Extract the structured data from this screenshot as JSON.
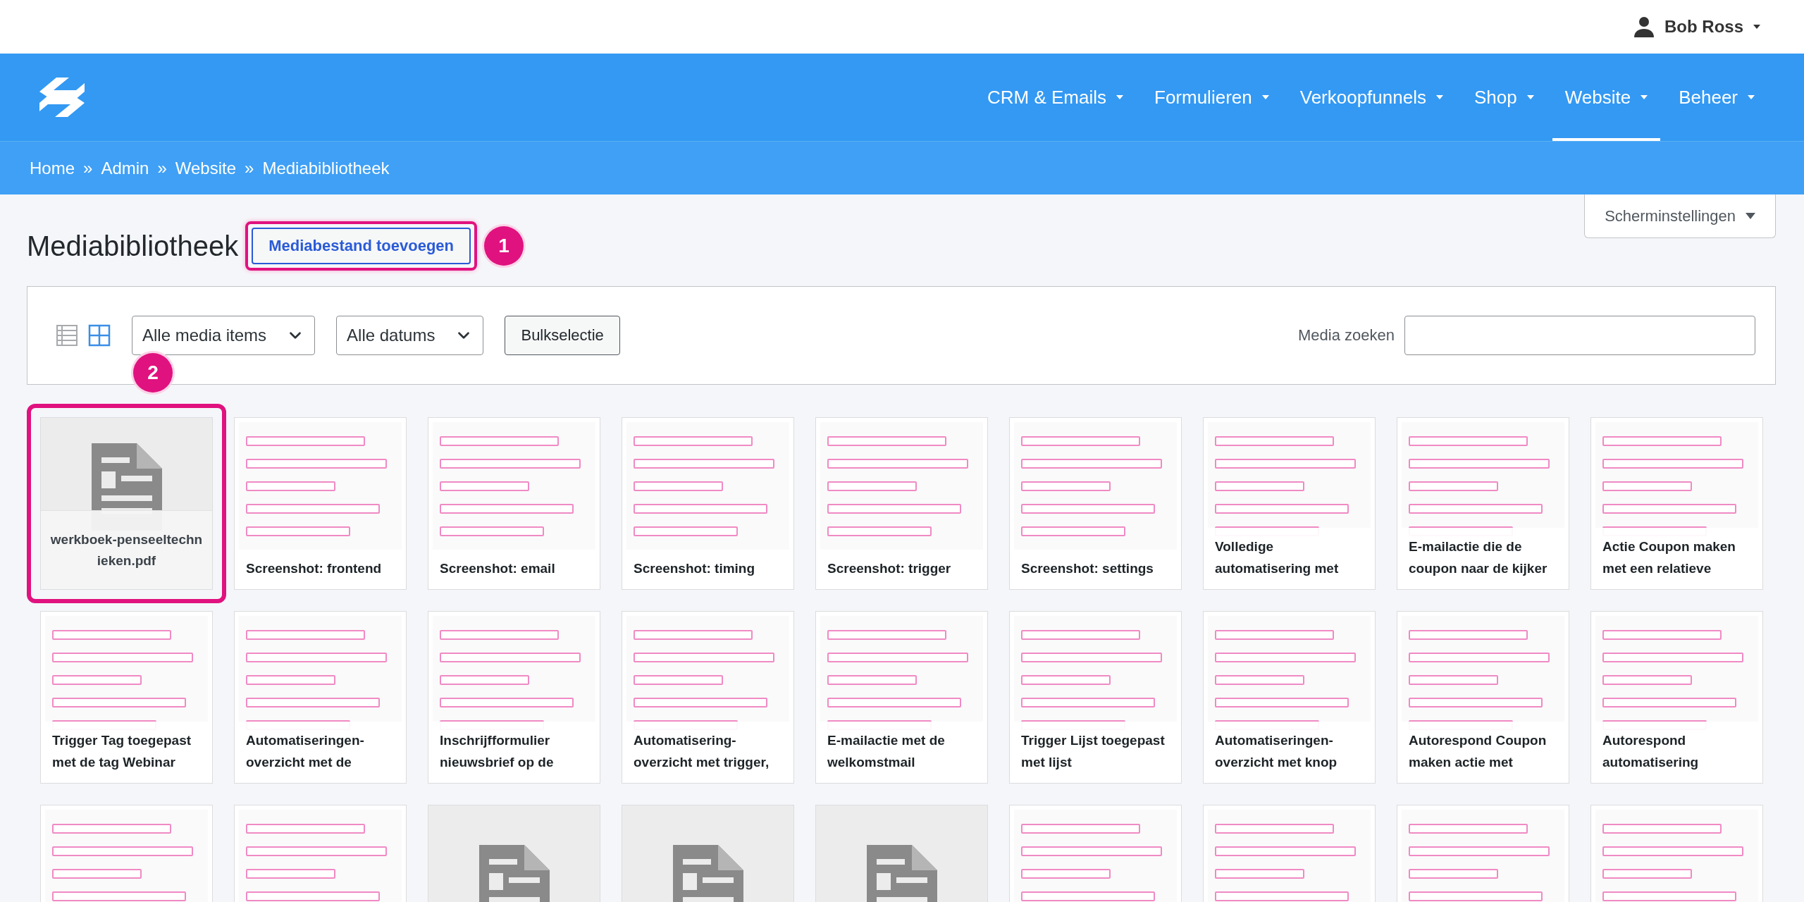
{
  "header": {
    "user": "Bob Ross"
  },
  "nav": {
    "items": [
      {
        "label": "CRM & Emails",
        "selected": false
      },
      {
        "label": "Formulieren",
        "selected": false
      },
      {
        "label": "Verkoopfunnels",
        "selected": false
      },
      {
        "label": "Shop",
        "selected": false
      },
      {
        "label": "Website",
        "selected": true
      },
      {
        "label": "Beheer",
        "selected": false
      }
    ]
  },
  "breadcrumb": [
    "Home",
    "»",
    "Admin",
    "»",
    "Website",
    "»",
    "Mediabibliotheek"
  ],
  "page": {
    "title": "Mediabibliotheek",
    "add_button": "Mediabestand toevoegen",
    "add_badge": "1",
    "screen_options": "Scherminstellingen"
  },
  "toolbar": {
    "views": [
      {
        "kind": "list",
        "selected": false
      },
      {
        "kind": "grid",
        "selected": true
      }
    ],
    "view_badge": "2",
    "filters": [
      "Alle media items",
      "Alle datums"
    ],
    "bulk_button": "Bulkselectie",
    "search_label": "Media zoeken"
  },
  "media": [
    {
      "kind": "document",
      "caption": "werkboek-penseeltechnieken.pdf",
      "selected": true
    },
    {
      "kind": "image",
      "caption": "Screenshot: frontend",
      "selected": false
    },
    {
      "kind": "image",
      "caption": "Screenshot: email",
      "selected": false
    },
    {
      "kind": "image",
      "caption": "Screenshot: timing",
      "selected": false
    },
    {
      "kind": "image",
      "caption": "Screenshot: trigger",
      "selected": false
    },
    {
      "kind": "image",
      "caption": "Screenshot: settings",
      "selected": false
    },
    {
      "kind": "image",
      "caption": "Volledige automatisering met",
      "selected": false
    },
    {
      "kind": "image",
      "caption": "E-mailactie die de coupon naar de kijker",
      "selected": false
    },
    {
      "kind": "image",
      "caption": "Actie Coupon maken met een relatieve",
      "selected": false
    },
    {
      "kind": "image",
      "caption": "Trigger Tag toegepast met de tag Webinar",
      "selected": false
    },
    {
      "kind": "image",
      "caption": "Automatiseringen-overzicht met de",
      "selected": false
    },
    {
      "kind": "image",
      "caption": "Inschrijfformulier nieuwsbrief op de",
      "selected": false
    },
    {
      "kind": "image",
      "caption": "Automatisering-overzicht met trigger,",
      "selected": false
    },
    {
      "kind": "image",
      "caption": "E-mailactie met de welkomstmail",
      "selected": false
    },
    {
      "kind": "image",
      "caption": "Trigger Lijst toegepast met lijst",
      "selected": false
    },
    {
      "kind": "image",
      "caption": "Automatiseringen-overzicht met knop",
      "selected": false
    },
    {
      "kind": "image",
      "caption": "Autorespond Coupon maken actie met",
      "selected": false
    },
    {
      "kind": "image",
      "caption": "Autorespond automatisering",
      "selected": false
    },
    {
      "kind": "image",
      "selected": false
    },
    {
      "kind": "image",
      "selected": false
    },
    {
      "kind": "document",
      "selected": false
    },
    {
      "kind": "document",
      "selected": false
    },
    {
      "kind": "document",
      "selected": false
    },
    {
      "kind": "image",
      "selected": false
    },
    {
      "kind": "image",
      "selected": false
    },
    {
      "kind": "image",
      "selected": false
    },
    {
      "kind": "image",
      "selected": false
    }
  ]
}
